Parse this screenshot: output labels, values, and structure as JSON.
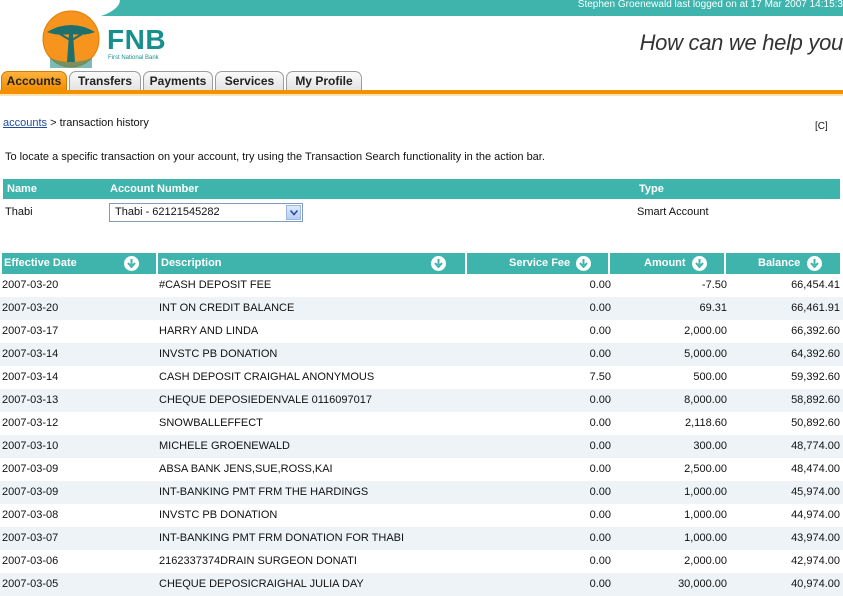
{
  "header": {
    "last_logged": "Stephen Groenewald last logged on at 17 Mar 2007 14:15:3",
    "brand": "FNB",
    "brand_sub": "First National Bank",
    "tagline": "How can we help you",
    "accent_color": "#3fb4ad",
    "tab_active_color": "#f39200"
  },
  "tabs": [
    {
      "label": "Accounts",
      "active": true
    },
    {
      "label": "Transfers",
      "active": false
    },
    {
      "label": "Payments",
      "active": false
    },
    {
      "label": "Services",
      "active": false
    },
    {
      "label": "My Profile",
      "active": false
    }
  ],
  "breadcrumb": {
    "link": "accounts",
    "rest": " > transaction history"
  },
  "corner_link": "[C]",
  "info_text": "To locate a specific transaction on your account, try using the Transaction Search functionality in the action bar.",
  "account_table": {
    "headers": {
      "name": "Name",
      "number": "Account Number",
      "type": "Type"
    },
    "row": {
      "name": "Thabi",
      "selected_account": "Thabi - 62121545282",
      "type": "Smart Account"
    }
  },
  "tx_table": {
    "headers": {
      "date": "Effective Date",
      "desc": "Description",
      "fee": "Service Fee",
      "amount": "Amount",
      "balance": "Balance"
    },
    "sort_icon": "sort-down-arrow-icon",
    "rows": [
      {
        "date": "2007-03-20",
        "desc": "#CASH DEPOSIT FEE",
        "fee": "0.00",
        "amount": "-7.50",
        "balance": "66,454.41"
      },
      {
        "date": "2007-03-20",
        "desc": "INT ON CREDIT BALANCE",
        "fee": "0.00",
        "amount": "69.31",
        "balance": "66,461.91"
      },
      {
        "date": "2007-03-17",
        "desc": "HARRY AND LINDA",
        "fee": "0.00",
        "amount": "2,000.00",
        "balance": "66,392.60"
      },
      {
        "date": "2007-03-14",
        "desc": "INVSTC PB DONATION",
        "fee": "0.00",
        "amount": "5,000.00",
        "balance": "64,392.60"
      },
      {
        "date": "2007-03-14",
        "desc": "CASH DEPOSIT CRAIGHAL ANONYMOUS",
        "fee": "7.50",
        "amount": "500.00",
        "balance": "59,392.60"
      },
      {
        "date": "2007-03-13",
        "desc": "CHEQUE DEPOSIEDENVALE 0116097017",
        "fee": "0.00",
        "amount": "8,000.00",
        "balance": "58,892.60"
      },
      {
        "date": "2007-03-12",
        "desc": "SNOWBALLEFFECT",
        "fee": "0.00",
        "amount": "2,118.60",
        "balance": "50,892.60"
      },
      {
        "date": "2007-03-10",
        "desc": "MICHELE GROENEWALD",
        "fee": "0.00",
        "amount": "300.00",
        "balance": "48,774.00"
      },
      {
        "date": "2007-03-09",
        "desc": "ABSA BANK JENS,SUE,ROSS,KAI",
        "fee": "0.00",
        "amount": "2,500.00",
        "balance": "48,474.00"
      },
      {
        "date": "2007-03-09",
        "desc": "INT-BANKING PMT FRM THE HARDINGS",
        "fee": "0.00",
        "amount": "1,000.00",
        "balance": "45,974.00"
      },
      {
        "date": "2007-03-08",
        "desc": "INVSTC PB DONATION",
        "fee": "0.00",
        "amount": "1,000.00",
        "balance": "44,974.00"
      },
      {
        "date": "2007-03-07",
        "desc": "INT-BANKING PMT FRM DONATION FOR THABI",
        "fee": "0.00",
        "amount": "1,000.00",
        "balance": "43,974.00"
      },
      {
        "date": "2007-03-06",
        "desc": "2162337374DRAIN SURGEON DONATI",
        "fee": "0.00",
        "amount": "2,000.00",
        "balance": "42,974.00"
      },
      {
        "date": "2007-03-05",
        "desc": "CHEQUE DEPOSICRAIGHAL JULIA DAY",
        "fee": "0.00",
        "amount": "30,000.00",
        "balance": "40,974.00"
      }
    ]
  }
}
